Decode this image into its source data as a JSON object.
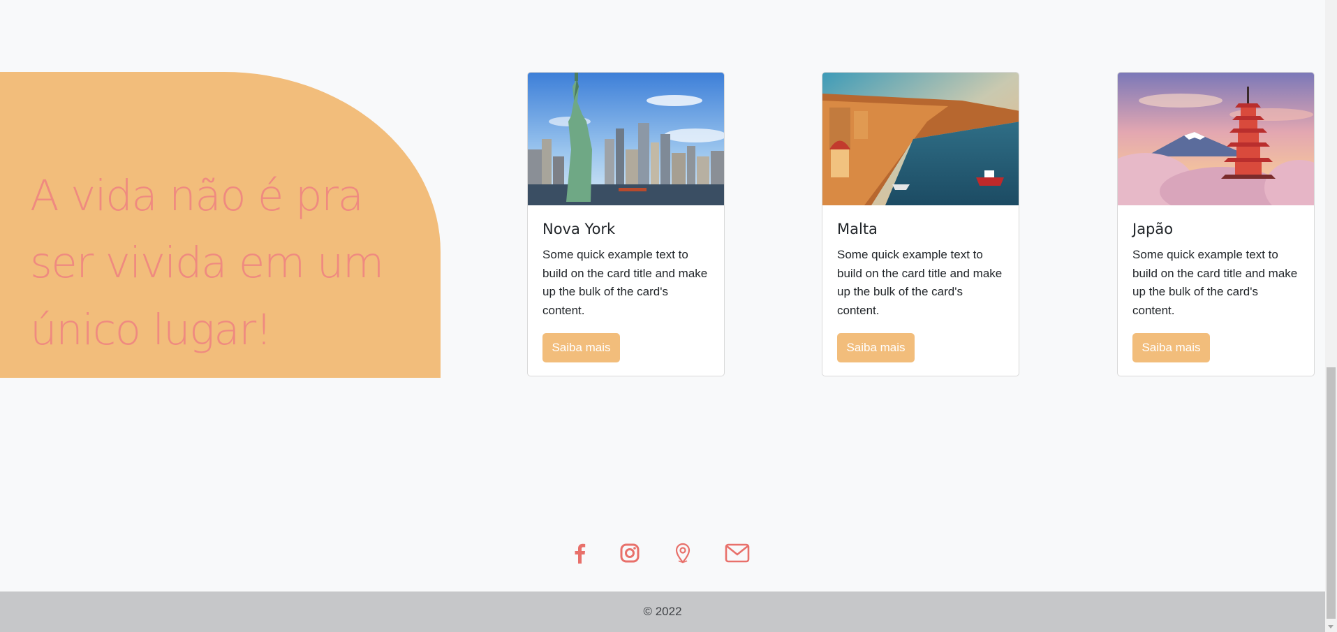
{
  "hero": {
    "headline": "A vida não é pra ser vivida em um único lugar!"
  },
  "cards": [
    {
      "title": "Nova York",
      "text": "Some quick example text to build on the card title and make up the bulk of the card's content.",
      "button_label": "Saiba mais"
    },
    {
      "title": "Malta",
      "text": "Some quick example text to build on the card title and make up the bulk of the card's content.",
      "button_label": "Saiba mais"
    },
    {
      "title": "Japão",
      "text": "Some quick example text to build on the card title and make up the bulk of the card's content.",
      "button_label": "Saiba mais"
    }
  ],
  "social": {
    "icons": [
      "facebook-icon",
      "instagram-icon",
      "location-pin-icon",
      "envelope-icon"
    ]
  },
  "footer": {
    "copyright": "© 2022"
  },
  "colors": {
    "accent": "#f2bd7b",
    "headline": "#ef8a80",
    "icon": "#e8706a",
    "footer_bg": "#c6c7c9",
    "page_bg": "#f8f9fa"
  }
}
